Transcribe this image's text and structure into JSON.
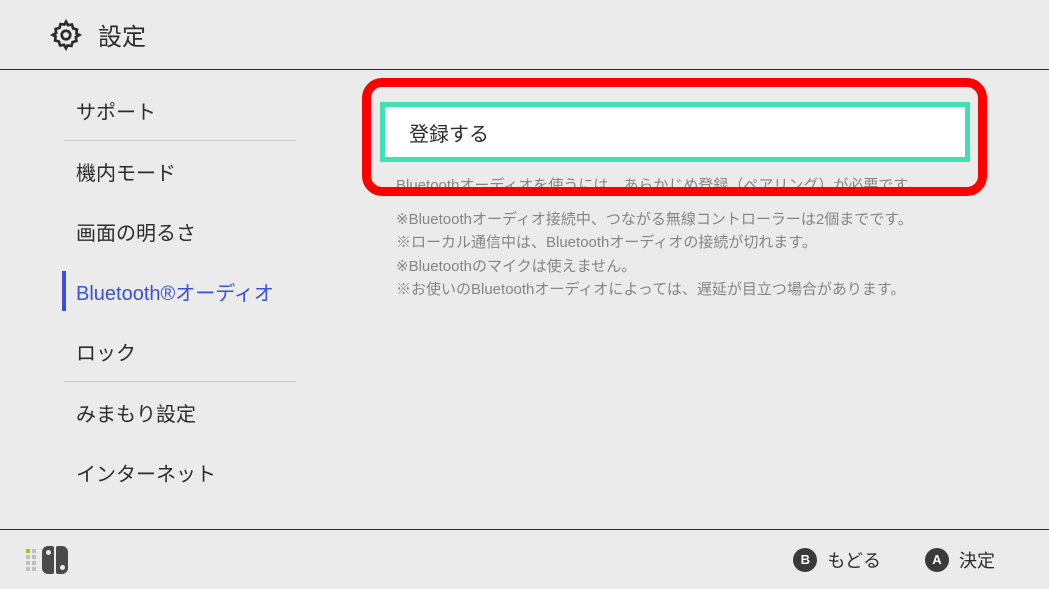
{
  "header": {
    "title": "設定"
  },
  "sidebar": {
    "items": [
      {
        "label": "サポート"
      },
      {
        "label": "機内モード"
      },
      {
        "label": "画面の明るさ"
      },
      {
        "label": "Bluetooth®オーディオ"
      },
      {
        "label": "ロック"
      },
      {
        "label": "みまもり設定"
      },
      {
        "label": "インターネット"
      }
    ]
  },
  "content": {
    "register_label": "登録する",
    "note_main": "Bluetoothオーディオを使うには、あらかじめ登録（ペアリング）が必要です。",
    "note1": "※Bluetoothオーディオ接続中、つながる無線コントローラーは2個までです。",
    "note2": "※ローカル通信中は、Bluetoothオーディオの接続が切れます。",
    "note3": "※Bluetoothのマイクは使えません。",
    "note4": "※お使いのBluetoothオーディオによっては、遅延が目立つ場合があります。"
  },
  "footer": {
    "back": {
      "glyph": "B",
      "label": "もどる"
    },
    "confirm": {
      "glyph": "A",
      "label": "決定"
    }
  }
}
